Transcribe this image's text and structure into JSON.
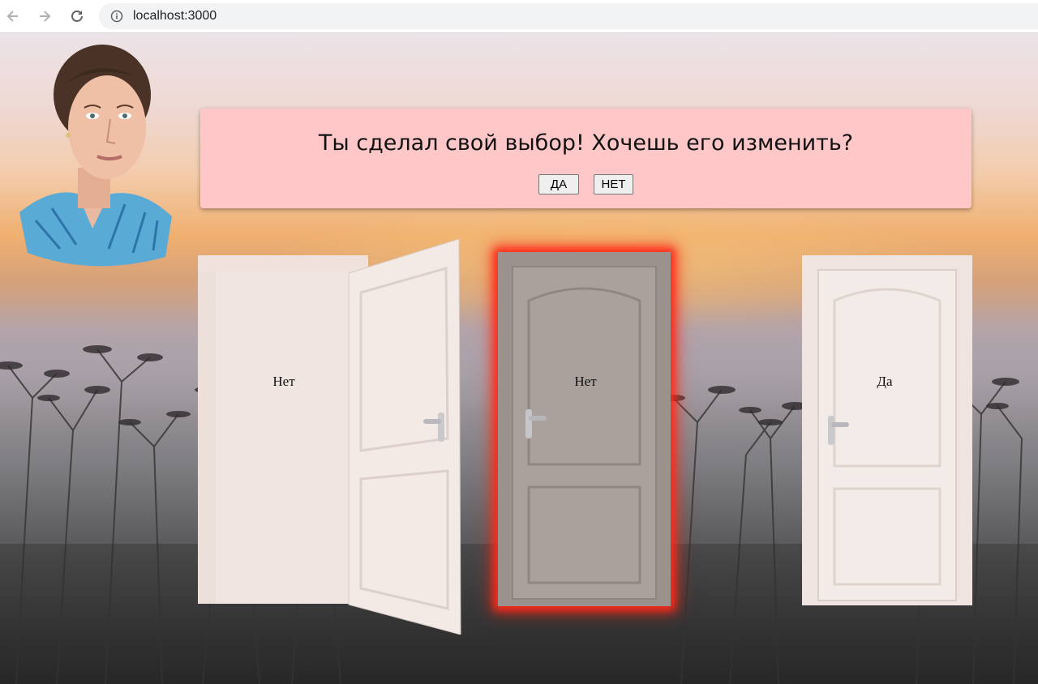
{
  "browser": {
    "url": "localhost:3000",
    "icons": {
      "back": "arrow-left-icon",
      "forward": "arrow-right-icon",
      "reload": "reload-icon",
      "info": "info-icon"
    }
  },
  "dialog": {
    "question": "Ты сделал свой выбор! Хочешь его изменить?",
    "yes_label": "ДА",
    "no_label": "НЕТ",
    "background": "#ffc7c7"
  },
  "doors": [
    {
      "label": "Нет",
      "state": "open",
      "selected": false
    },
    {
      "label": "Нет",
      "state": "closed",
      "selected": true,
      "color": "#a9a09b"
    },
    {
      "label": "Да",
      "state": "closed",
      "selected": false,
      "color": "#f1e6e2"
    }
  ],
  "colors": {
    "selection_glow": "#ff2a1a"
  }
}
